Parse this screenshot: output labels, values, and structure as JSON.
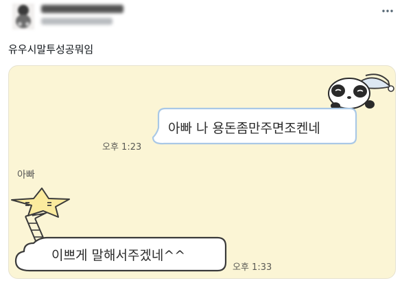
{
  "tweet": {
    "text": "유우시말투성공뭐임"
  },
  "chat": {
    "sent_message": "아빠 나 용돈좀만주면조켄네",
    "sent_time": "오후 1:23",
    "sender_name": "아빠",
    "received_message": "이쁘게 말해서주겠네^^",
    "received_time": "오후 1:33"
  },
  "colors": {
    "chat_background": "#fbf5d5",
    "bubble_fill": "#ffffff",
    "bubble_outline": "#a9c8e6",
    "star": "#fbeb9e"
  },
  "icons": {
    "avatar": "profile-avatar-icon",
    "more": "more-options-icon",
    "panda": "panda-sticker-icon",
    "star": "star-ladder-sticker-icon"
  }
}
